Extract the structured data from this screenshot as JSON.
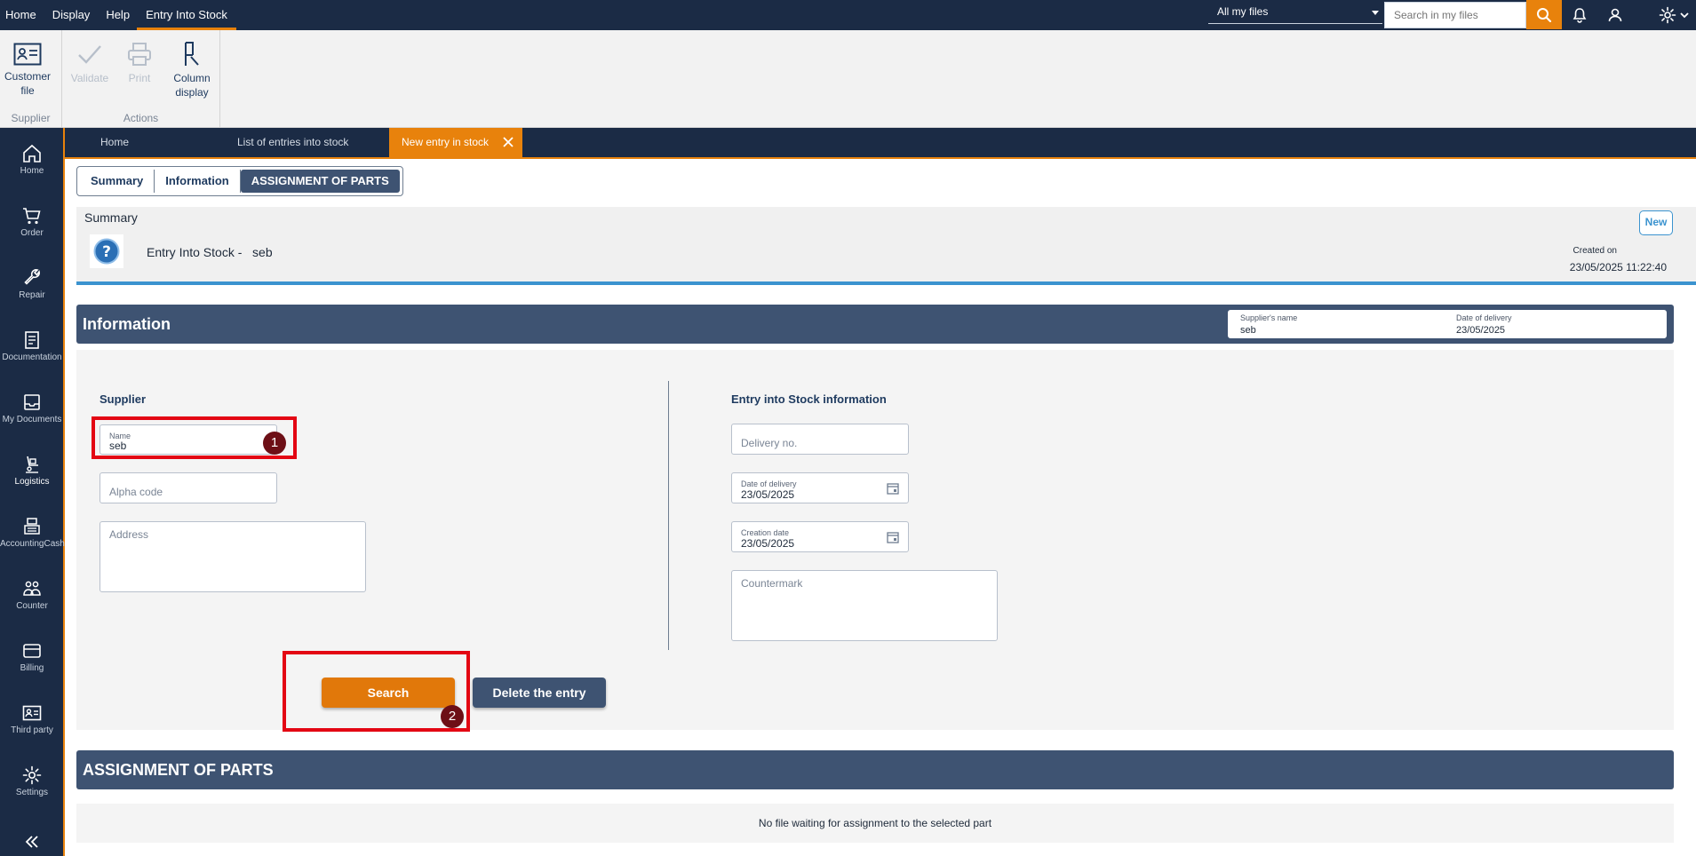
{
  "menu": [
    {
      "label": "Home"
    },
    {
      "label": "Display"
    },
    {
      "label": "Help"
    },
    {
      "label": "Entry Into Stock",
      "active": true
    }
  ],
  "topbar": {
    "scope": "All my files",
    "search_placeholder": "Search in my files",
    "icons": [
      "search-icon",
      "bell-icon",
      "user-icon",
      "gear-icon",
      "chevron-down-icon"
    ]
  },
  "ribbon": {
    "groups": [
      {
        "label": "Supplier",
        "buttons": [
          {
            "label": "Customer file",
            "icon": "id-card-icon",
            "enabled": true
          }
        ]
      },
      {
        "label": "Actions",
        "buttons": [
          {
            "label": "Validate",
            "icon": "check-icon",
            "enabled": false
          },
          {
            "label": "Print",
            "icon": "printer-icon",
            "enabled": false
          },
          {
            "label": "Column display",
            "icon": "column-icon",
            "enabled": true
          }
        ]
      }
    ]
  },
  "sidebar": {
    "items": [
      {
        "label": "Home",
        "icon": "home-icon"
      },
      {
        "label": "Order",
        "icon": "cart-icon"
      },
      {
        "label": "Repair",
        "icon": "wrench-icon"
      },
      {
        "label": "Documentation",
        "icon": "document-icon"
      },
      {
        "label": "My Documents",
        "icon": "inbox-icon"
      },
      {
        "label": "Logistics",
        "icon": "logistics-icon",
        "active": true
      },
      {
        "label": "AccountingCash",
        "icon": "cash-register-icon"
      },
      {
        "label": "Counter",
        "icon": "people-icon"
      },
      {
        "label": "Billing",
        "icon": "card-icon"
      },
      {
        "label": "Third party",
        "icon": "id-card-icon"
      },
      {
        "label": "Settings",
        "icon": "gear-icon"
      }
    ]
  },
  "doc_tabs": [
    {
      "label": "Home"
    },
    {
      "label": "List of entries into stock",
      "closable": true
    },
    {
      "label": "New entry in stock",
      "closable": true,
      "active": true
    }
  ],
  "segments": [
    {
      "label": "Summary"
    },
    {
      "label": "Information"
    },
    {
      "label": "ASSIGNMENT OF PARTS",
      "active": true
    }
  ],
  "summary": {
    "title": "Summary",
    "entry_label": "Entry Into Stock -",
    "entry_name": "seb",
    "status": "New",
    "created_label": "Created on",
    "created_value": "23/05/2025 11:22:40"
  },
  "information": {
    "title": "Information",
    "supplier_name_label": "Supplier's name",
    "supplier_name_value": "seb",
    "delivery_date_label": "Date of delivery",
    "delivery_date_value": "23/05/2025"
  },
  "supplier": {
    "title": "Supplier",
    "name_label": "Name",
    "name_value": "seb",
    "alpha_placeholder": "Alpha code",
    "address_placeholder": "Address"
  },
  "stock_info": {
    "title": "Entry into Stock information",
    "delivery_no_placeholder": "Delivery no.",
    "delivery_date_label": "Date of delivery",
    "delivery_date_value": "23/05/2025",
    "creation_date_label": "Creation date",
    "creation_date_value": "23/05/2025",
    "countermark_placeholder": "Countermark"
  },
  "actions": {
    "search": "Search",
    "delete": "Delete the entry"
  },
  "annotations": [
    "1",
    "2"
  ],
  "assignment": {
    "title": "ASSIGNMENT OF PARTS",
    "empty": "No file waiting for assignment to the selected part"
  },
  "colors": {
    "navy": "#1b2b45",
    "slate": "#3e5372",
    "accent": "#e8820c",
    "blue": "#3b93cf",
    "highlight": "#e30613"
  }
}
